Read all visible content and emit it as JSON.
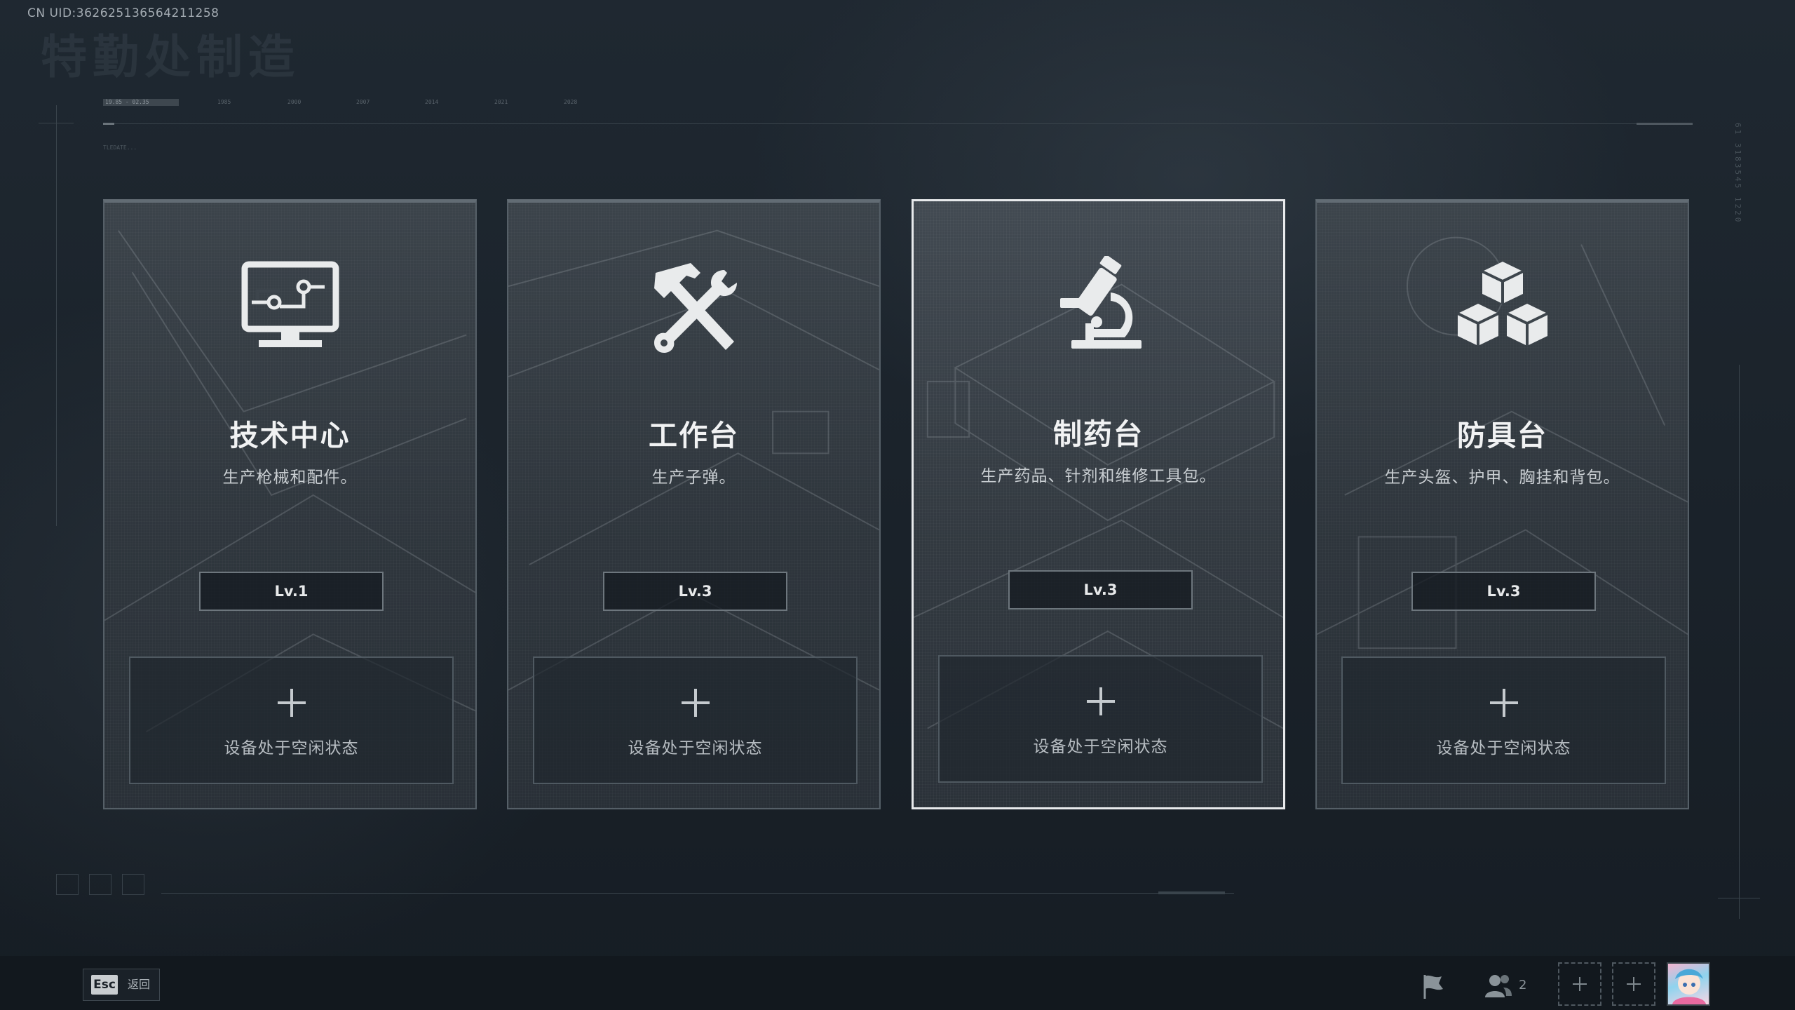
{
  "header": {
    "uid_text": "CN UID:362625136564211258",
    "watermark_title": "特勤处制造"
  },
  "timeline": {
    "range_label": "19.85 - 02.35",
    "years": [
      "1985",
      "2000",
      "2007",
      "2014",
      "2021",
      "2028"
    ],
    "sub_label": "TLEDATE..."
  },
  "side_code": "61 3183545 1220",
  "cards": [
    {
      "name": "技术中心",
      "description": "生产枪械和配件。",
      "level": "Lv.1",
      "slot_status": "设备处于空闲状态",
      "icon": "computer-monitor-icon",
      "selected": false
    },
    {
      "name": "工作台",
      "description": "生产子弹。",
      "level": "Lv.3",
      "slot_status": "设备处于空闲状态",
      "icon": "hammer-wrench-icon",
      "selected": false
    },
    {
      "name": "制药台",
      "description": "生产药品、针剂和维修工具包。",
      "level": "Lv.3",
      "slot_status": "设备处于空闲状态",
      "icon": "microscope-icon",
      "selected": true
    },
    {
      "name": "防具台",
      "description": "生产头盔、护甲、胸挂和背包。",
      "level": "Lv.3",
      "slot_status": "设备处于空闲状态",
      "icon": "stacked-cubes-icon",
      "selected": false
    }
  ],
  "footer": {
    "esc_key": "Esc",
    "esc_label": "返回",
    "team_count": "2"
  },
  "colors": {
    "background": "#1a2129",
    "card_border": "#555f67",
    "selected_border": "#e8eaec",
    "text_primary": "#f1f2f3"
  }
}
